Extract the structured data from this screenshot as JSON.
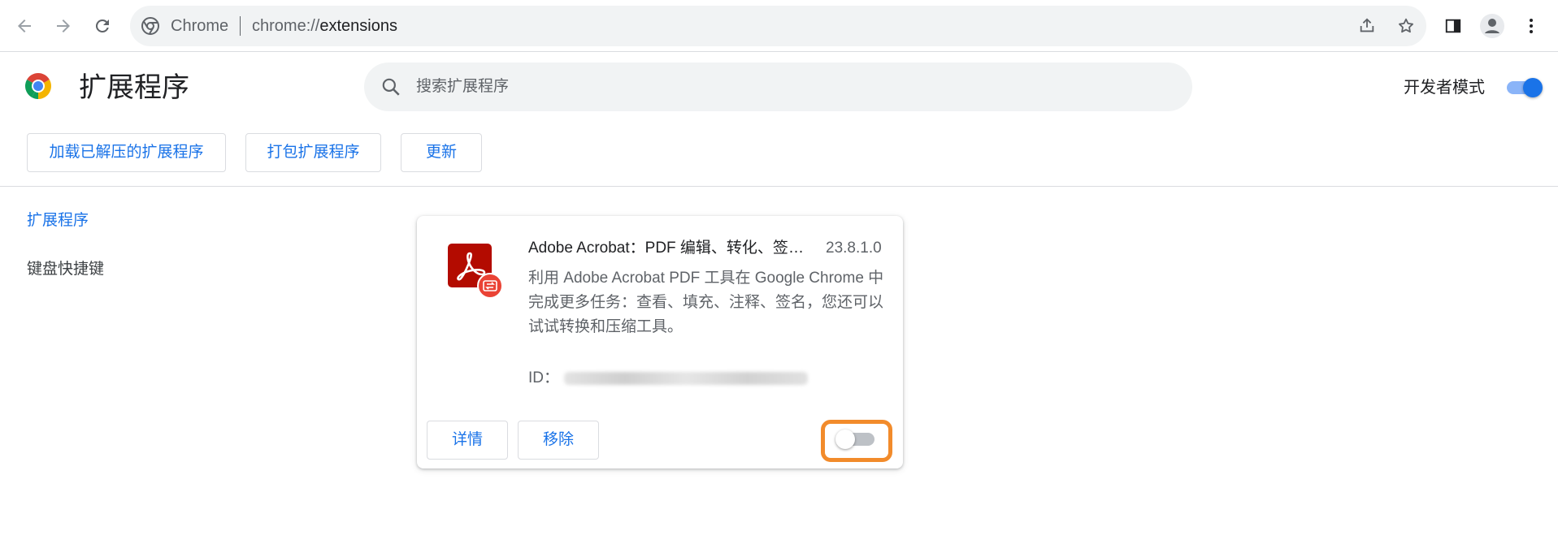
{
  "browser": {
    "omnibox_scheme": "Chrome",
    "omnibox_url_prefix": "chrome://",
    "omnibox_url_host": "extensions",
    "icons": [
      "back-icon",
      "forward-icon",
      "reload-icon",
      "share-icon",
      "bookmark-star-icon",
      "side-panel-icon",
      "profile-icon",
      "menu-icon"
    ]
  },
  "header": {
    "title": "扩展程序",
    "search_placeholder": "搜索扩展程序",
    "dev_mode_label": "开发者模式",
    "dev_mode_on": true
  },
  "actions": {
    "load_unpacked": "加载已解压的扩展程序",
    "pack": "打包扩展程序",
    "update": "更新"
  },
  "sidebar": {
    "items": [
      {
        "label": "扩展程序",
        "active": true
      },
      {
        "label": "键盘快捷键",
        "active": false
      }
    ]
  },
  "extension": {
    "name": "Adobe Acrobat：PDF 编辑、转化、签名工具",
    "version": "23.8.1.0",
    "description": "利用 Adobe Acrobat PDF 工具在 Google Chrome 中完成更多任务：查看、填充、注释、签名，您还可以试试转换和压缩工具。",
    "id_label": "ID：",
    "details_button": "详情",
    "remove_button": "移除",
    "enabled": false
  },
  "colors": {
    "accent": "#1a73e8",
    "highlight": "#f28b2b",
    "acrobat_red": "#b30b00"
  }
}
